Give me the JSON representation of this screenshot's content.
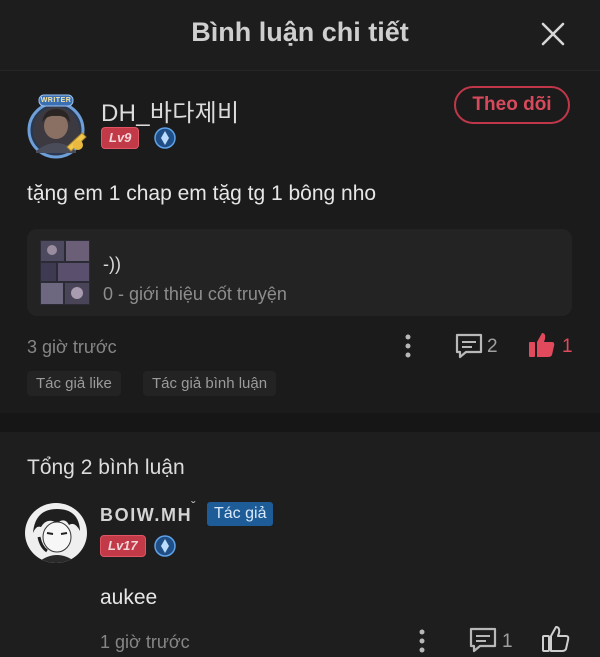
{
  "header": {
    "title": "Bình luận chi tiết"
  },
  "comment": {
    "username": "DH_바다제비",
    "avatar_frame_label": "WRITER",
    "level": "Lv9",
    "follow_label": "Theo dõi",
    "text": "tặng em 1 chap em tặg tg 1 bông nho",
    "manga": {
      "title": "-))",
      "subtitle": "0 - giới thiệu cốt truyện"
    },
    "time": "3 giờ trước",
    "reply_count": "2",
    "like_count": "1",
    "tags": [
      "Tác giả like",
      "Tác giả bình luận"
    ]
  },
  "replies": {
    "total_label": "Tổng 2 bình luận",
    "items": [
      {
        "username": "BOIW.MH",
        "author_badge": "Tác giả",
        "level": "Lv17",
        "text": "aukee",
        "time": "1 giờ trước",
        "reply_count": "1"
      }
    ]
  },
  "colors": {
    "accent_red": "#c0374a",
    "author_blue": "#1d5c97",
    "background": "#1b1b1b"
  }
}
